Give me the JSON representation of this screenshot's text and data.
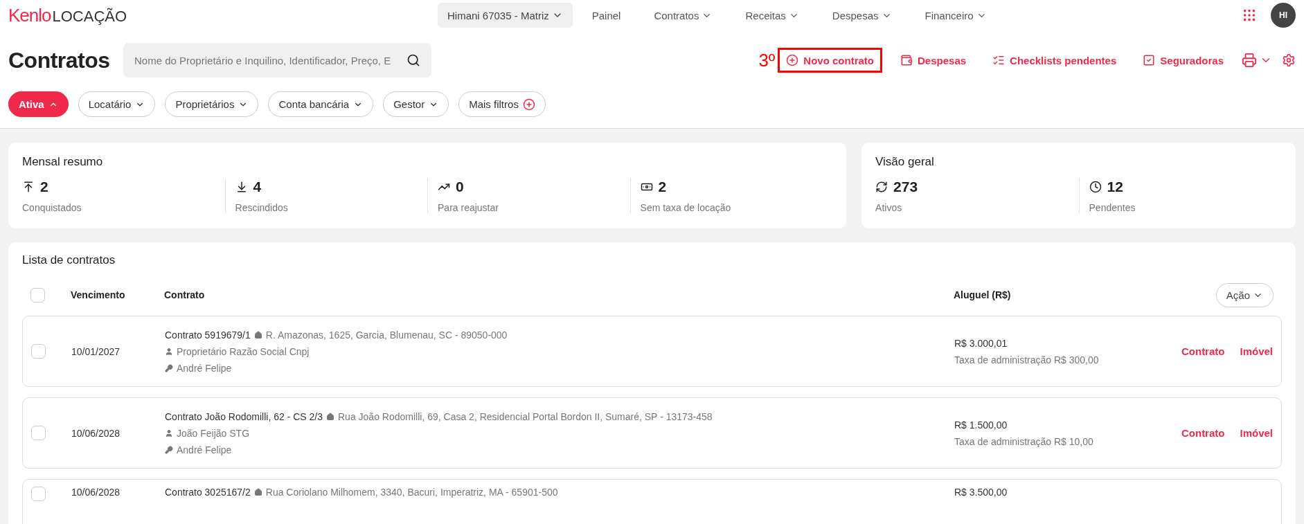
{
  "header": {
    "logo": {
      "brand": "Kenlo",
      "product": "LOCAÇÃO"
    },
    "account": "Himani 67035 - Matriz",
    "nav": [
      {
        "label": "Painel",
        "dropdown": false
      },
      {
        "label": "Contratos",
        "dropdown": true
      },
      {
        "label": "Receitas",
        "dropdown": true
      },
      {
        "label": "Despesas",
        "dropdown": true
      },
      {
        "label": "Financeiro",
        "dropdown": true
      }
    ],
    "avatar": "HI"
  },
  "page": {
    "title": "Contratos",
    "search": {
      "placeholder": "Nome do Proprietário e Inquilino, Identificador, Preço, E"
    },
    "actions": [
      {
        "kind": "new",
        "label": "Novo contrato",
        "highlighted": true,
        "marker": "3º"
      },
      {
        "kind": "expenses",
        "label": "Despesas",
        "highlighted": false
      },
      {
        "kind": "checklists",
        "label": "Checklists pendentes",
        "highlighted": false
      },
      {
        "kind": "insurers",
        "label": "Seguradoras",
        "highlighted": false
      },
      {
        "kind": "print",
        "highlighted": false
      },
      {
        "kind": "settings",
        "highlighted": false
      }
    ]
  },
  "filters": [
    {
      "kind": "dropdown",
      "label": "Ativa",
      "selected": true
    },
    {
      "kind": "dropdown",
      "label": "Locatário",
      "selected": false
    },
    {
      "kind": "dropdown",
      "label": "Proprietários",
      "selected": false
    },
    {
      "kind": "dropdown",
      "label": "Conta bancária",
      "selected": false
    },
    {
      "kind": "dropdown",
      "label": "Gestor",
      "selected": false
    },
    {
      "kind": "add",
      "label": "Mais filtros",
      "selected": false
    }
  ],
  "summary": {
    "title": "Mensal resumo",
    "stats": [
      {
        "kind": "won",
        "value": "2",
        "label": "Conquistados"
      },
      {
        "kind": "cancelled",
        "value": "4",
        "label": "Rescindidos"
      },
      {
        "kind": "adjust",
        "value": "0",
        "label": "Para reajustar"
      },
      {
        "kind": "nofee",
        "value": "2",
        "label": "Sem taxa de locação"
      }
    ]
  },
  "overview": {
    "title": "Visão geral",
    "stats": [
      {
        "kind": "active",
        "value": "273",
        "label": "Ativos"
      },
      {
        "kind": "pending",
        "value": "12",
        "label": "Pendentes"
      }
    ]
  },
  "list": {
    "title": "Lista de contratos",
    "header_checked": false,
    "columns": [
      "Vencimento",
      "Contrato",
      "Aluguel (R$)"
    ],
    "action_menu": "Ação",
    "rows": [
      {
        "checked": false,
        "due": "10/01/2027",
        "title": "Contrato 5919679/1",
        "address": "R. Amazonas, 1625, Garcia, Blumenau, SC - 89050-000",
        "owner": "Proprietário Razão Social Cnpj",
        "manager": "André Felipe",
        "rent": "R$ 3.000,01",
        "fee": "Taxa de administração R$ 300,00",
        "links": [
          "Contrato",
          "Imóvel"
        ]
      },
      {
        "checked": false,
        "due": "10/06/2028",
        "title": "Contrato João Rodomilli, 62 - CS 2/3",
        "address": "Rua João Rodomilli, 69, Casa 2, Residencial Portal Bordon II, Sumaré, SP - 13173-458",
        "owner": "João Feijão STG",
        "manager": "André Felipe",
        "rent": "R$ 1.500,00",
        "fee": "Taxa de administração R$ 10,00",
        "links": [
          "Contrato",
          "Imóvel"
        ]
      },
      {
        "checked": false,
        "due": "10/06/2028",
        "title": "Contrato 3025167/2",
        "address": "Rua Coriolano Milhomem, 3340, Bacuri, Imperatriz, MA - 65901-500",
        "rent": "R$ 3.500,00"
      }
    ]
  }
}
